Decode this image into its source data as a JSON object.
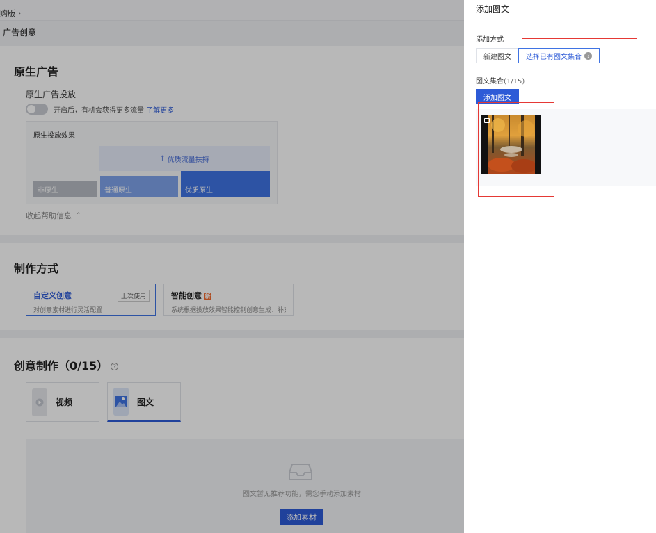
{
  "left": {
    "breadcrumb": {
      "text": "购版",
      "chevron": "chevron-right-icon"
    },
    "page_title": "广告创意",
    "native_ad": {
      "title": "原生广告",
      "delivery_label": "原生广告投放",
      "toggle_text": "开启后，有机会获得更多流量",
      "learn_more": "了解更多",
      "effect_title": "原生投放效果",
      "boost_label": "优质流量扶持",
      "bar_labels": [
        "非原生",
        "普通原生",
        "优质原生"
      ],
      "collapse_help": "收起帮助信息"
    },
    "production_method": {
      "title": "制作方式",
      "options": [
        {
          "title": "自定义创意",
          "desc": "对创意素材进行灵活配置",
          "tag": "上次使用"
        },
        {
          "title": "智能创意",
          "badge": "新",
          "desc": "系统根据投放效果智能控制创意生成、补充"
        }
      ]
    },
    "creative_make": {
      "title": "创意制作（0/15）",
      "types": [
        "视频",
        "图文"
      ],
      "empty_text": "图文暂无推荐功能，需您手动添加素材",
      "add_button": "添加素材"
    }
  },
  "drawer": {
    "title": "添加图文",
    "method_label": "添加方式",
    "methods": [
      "新建图文",
      "选择已有图文集合"
    ],
    "collection_label": "图文集合",
    "collection_count": "(1/15)",
    "add_button": "添加图文"
  },
  "colors": {
    "primary": "#2d5bd7",
    "highlight": "#e53935",
    "overlay": "rgba(0,0,0,0.28)"
  }
}
